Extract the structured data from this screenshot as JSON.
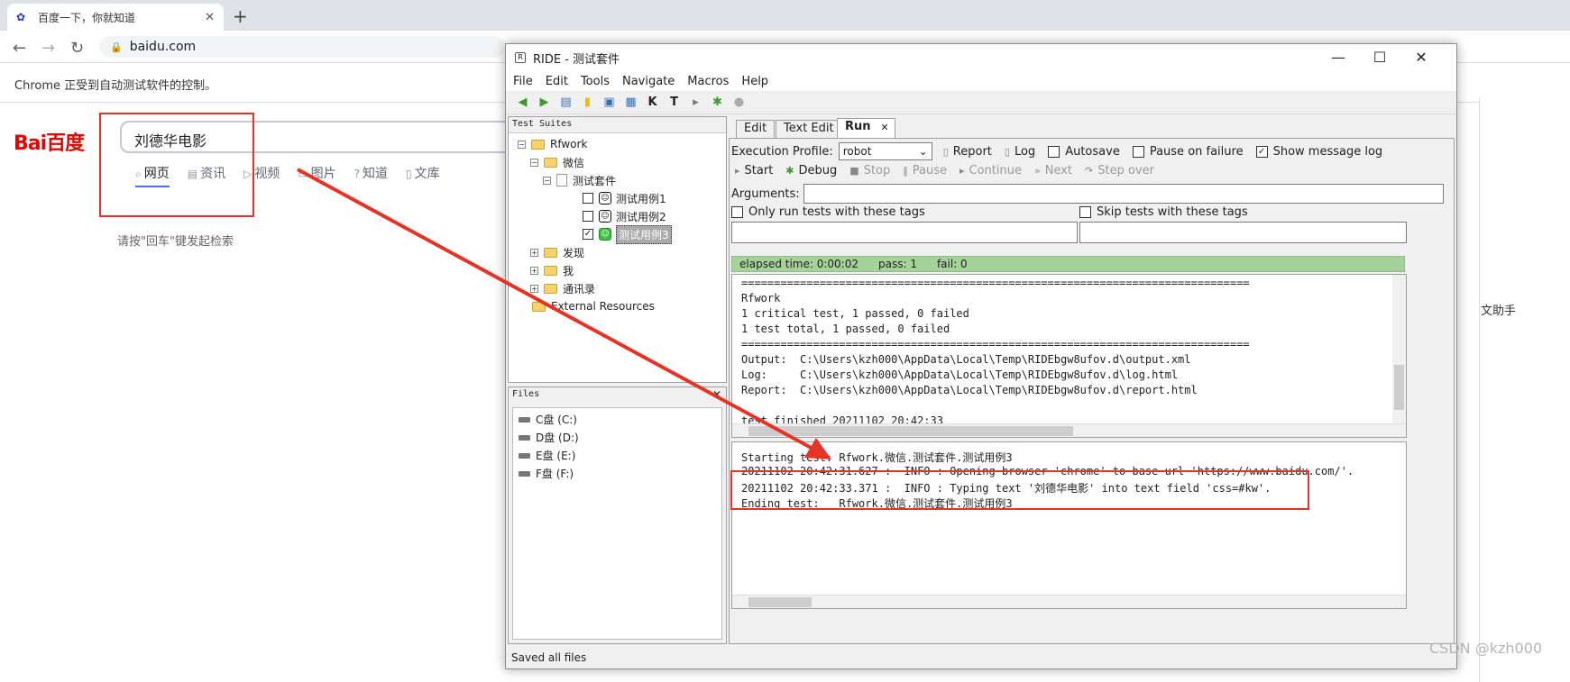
{
  "chrome": {
    "tab_title": "百度一下，你就知道",
    "url": "baidu.com",
    "automation_notice": "Chrome 正受到自动测试软件的控制。"
  },
  "baidu": {
    "logo_text": "Bai百度",
    "search_value": "刘德华电影",
    "tabs": [
      "网页",
      "资讯",
      "视频",
      "图片",
      "知道",
      "文库"
    ],
    "hint": "请按\"回车\"键发起检索"
  },
  "ghost_window": {
    "texts": [
      "文助手"
    ]
  },
  "ride": {
    "title": "RIDE - 测试套件",
    "menu": [
      "File",
      "Edit",
      "Tools",
      "Navigate",
      "Macros",
      "Help"
    ],
    "tree_header": "Test Suites",
    "tree": {
      "root": "Rfwork",
      "wechat": "微信",
      "suite": "测试套件",
      "cases": [
        "测试用例1",
        "测试用例2",
        "测试用例3"
      ],
      "discover": "发现",
      "me": "我",
      "contacts": "通讯录",
      "external": "External Resources"
    },
    "files_header": "Files",
    "drives": [
      "C盘 (C:)",
      "D盘 (D:)",
      "E盘 (E:)",
      "F盘 (F:)"
    ],
    "tabs": [
      "Edit",
      "Text Edit",
      "Run"
    ],
    "run": {
      "execution_profile_label": "Execution Profile:",
      "profile_value": "robot",
      "report_label": "Report",
      "log_label": "Log",
      "autosave_label": "Autosave",
      "pause_on_failure_label": "Pause on failure",
      "show_message_log_label": "Show message log",
      "controls": [
        "Start",
        "Debug",
        "Stop",
        "Pause",
        "Continue",
        "Next",
        "Step over"
      ],
      "arguments_label": "Arguments:",
      "only_tags_label": "Only run tests with these tags",
      "skip_tags_label": "Skip tests with these tags",
      "elapsed": "elapsed time: 0:00:02",
      "pass": "pass: 1",
      "fail": "fail: 0"
    },
    "output_lines": [
      "==============================================================================",
      "Rfwork",
      "1 critical test, 1 passed, 0 failed",
      "1 test total, 1 passed, 0 failed",
      "==============================================================================",
      "Output:  C:\\Users\\kzh000\\AppData\\Local\\Temp\\RIDEbgw8ufov.d\\output.xml",
      "Log:     C:\\Users\\kzh000\\AppData\\Local\\Temp\\RIDEbgw8ufov.d\\log.html",
      "Report:  C:\\Users\\kzh000\\AppData\\Local\\Temp\\RIDEbgw8ufov.d\\report.html",
      "",
      "test finished 20211102 20:42:33"
    ],
    "message_lines": [
      "Starting test: Rfwork.微信.测试套件.测试用例3",
      "20211102 20:42:31.627 :  INFO : Opening browser 'chrome' to base url 'https://www.baidu.com/'.",
      "20211102 20:42:33.371 :  INFO : Typing text '刘德华电影' into text field 'css=#kw'.",
      "Ending test:   Rfwork.微信.测试套件.测试用例3"
    ],
    "status": "Saved all files"
  },
  "watermark": "CSDN @kzh000",
  "colors": {
    "annotation_red": "#e53325",
    "pass_green": "#a5d19b",
    "baidu_blue": "#2932e1",
    "baidu_red": "#e10602"
  }
}
